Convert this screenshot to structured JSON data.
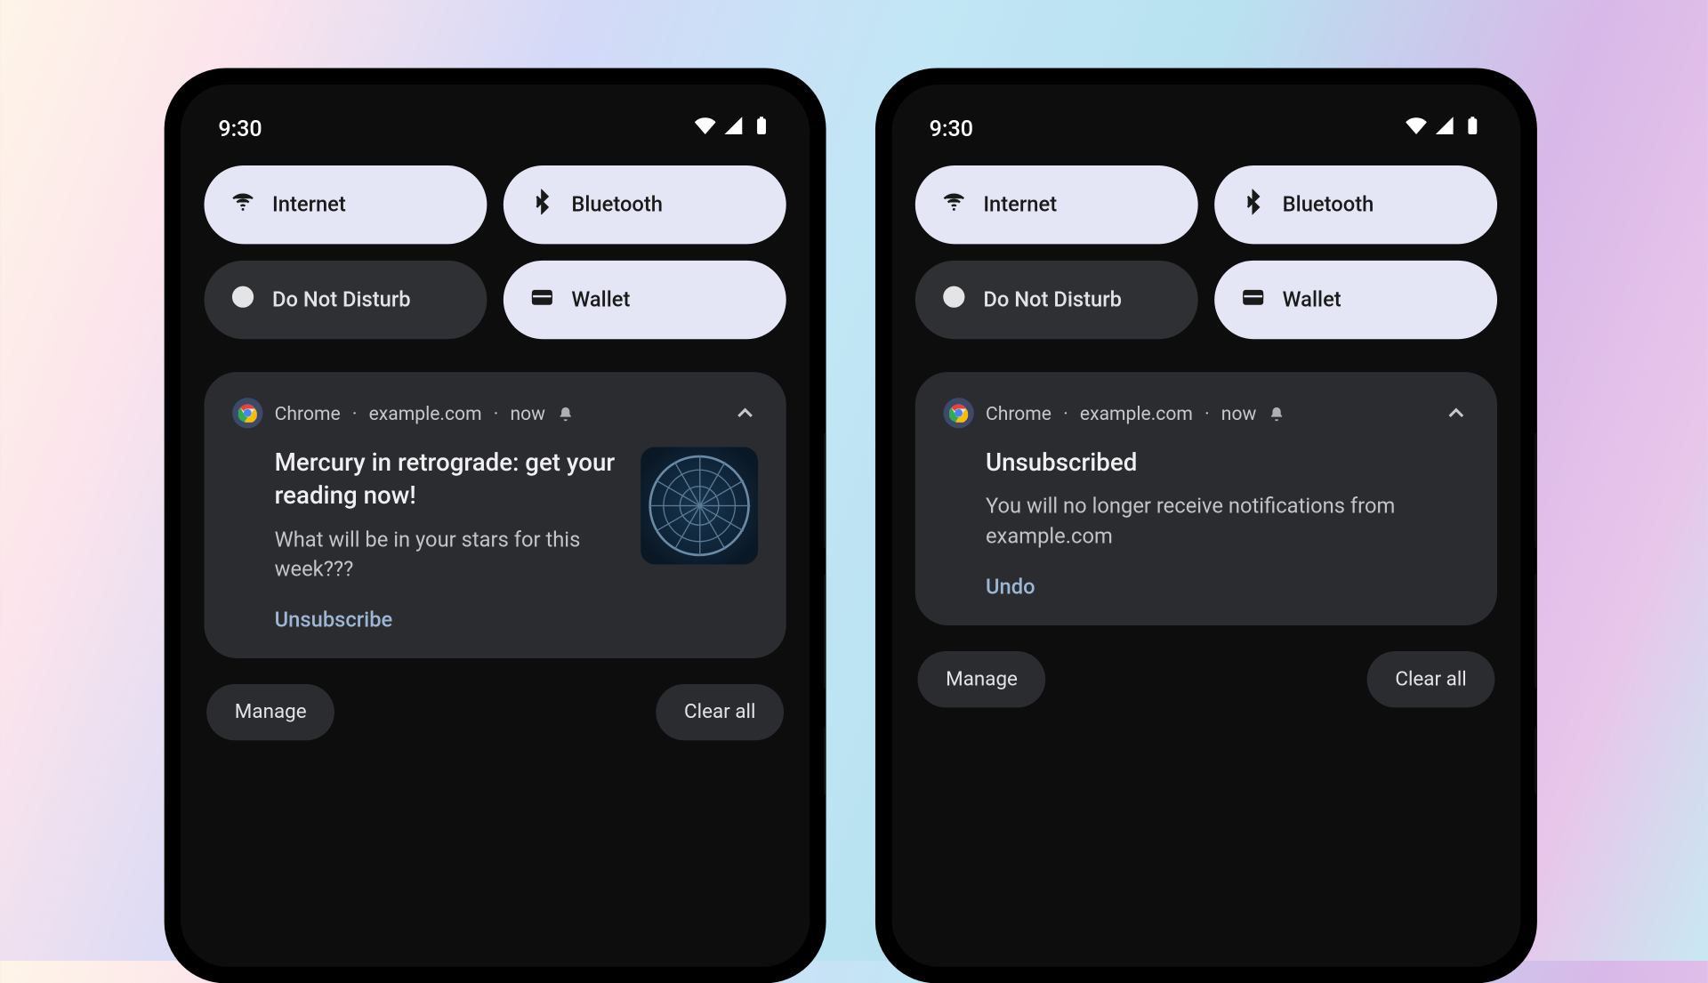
{
  "status": {
    "time": "9:30"
  },
  "qs": {
    "internet": "Internet",
    "bluetooth": "Bluetooth",
    "dnd": "Do Not Disturb",
    "wallet": "Wallet"
  },
  "notif_meta": {
    "app": "Chrome",
    "site": "example.com",
    "when": "now",
    "sep": " · "
  },
  "left": {
    "title": "Mercury in retrograde: get your reading now!",
    "subtitle": "What will be in your stars for this week???",
    "action": "Unsubscribe"
  },
  "right": {
    "title": "Unsubscribed",
    "subtitle": "You will no longer receive notifications from example.com",
    "action": "Undo"
  },
  "footer": {
    "manage": "Manage",
    "clear": "Clear all"
  }
}
